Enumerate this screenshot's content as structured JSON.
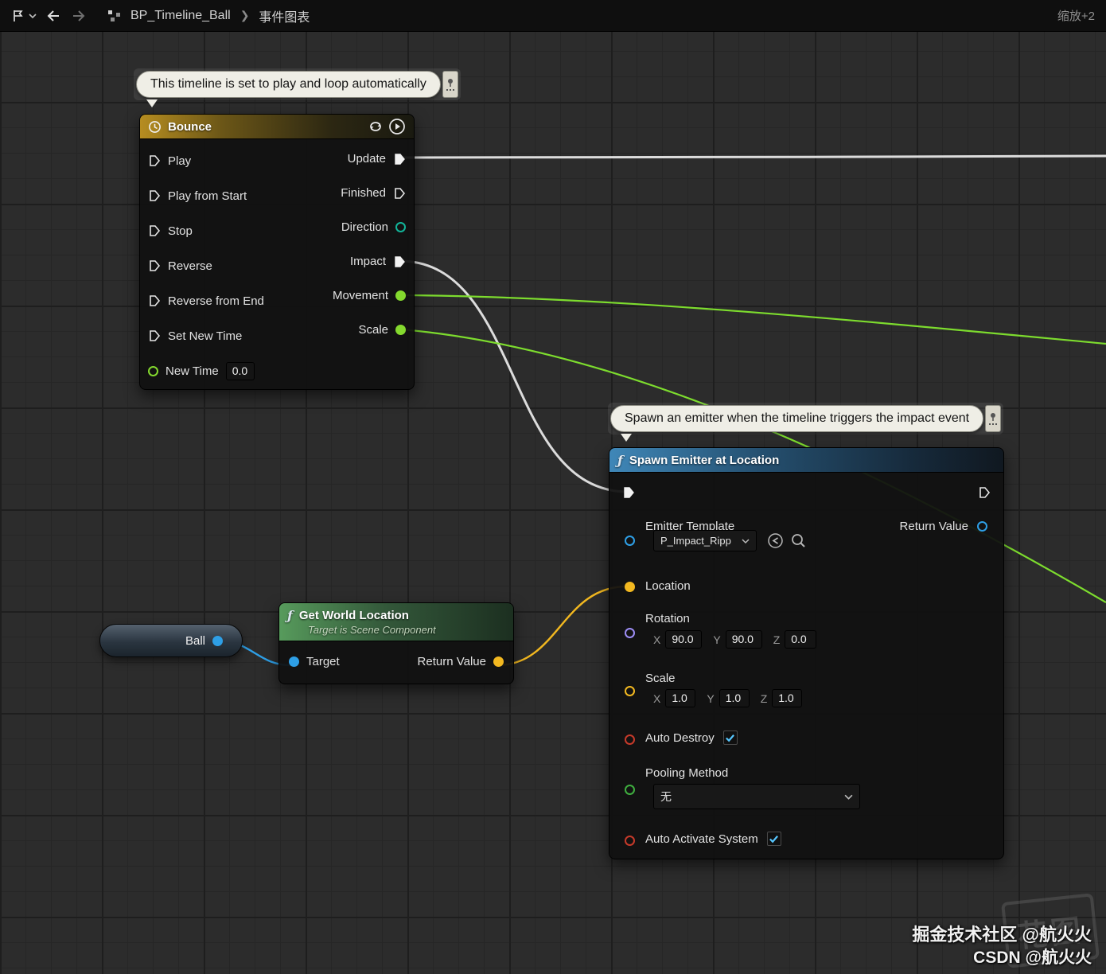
{
  "toolbar": {
    "breadcrumb_root": "BP_Timeline_Ball",
    "breadcrumb_sep": "❯",
    "breadcrumb_page": "事件图表",
    "zoom_label": "缩放+2"
  },
  "comments": {
    "timeline_note": "This timeline is set to play and loop automatically",
    "spawn_note": "Spawn an emitter when the timeline triggers the impact event"
  },
  "bounce_node": {
    "title": "Bounce",
    "inputs": [
      "Play",
      "Play from Start",
      "Stop",
      "Reverse",
      "Reverse from End",
      "Set New Time"
    ],
    "new_time_label": "New Time",
    "new_time_value": "0.0",
    "outputs": [
      "Update",
      "Finished",
      "Direction",
      "Impact",
      "Movement",
      "Scale"
    ]
  },
  "spawn_node": {
    "title": "Spawn Emitter at Location",
    "emitter_template_label": "Emitter Template",
    "emitter_template_value": "P_Impact_Ripp",
    "return_value_label": "Return Value",
    "location_label": "Location",
    "rotation_label": "Rotation",
    "rotation": {
      "x": "90.0",
      "y": "90.0",
      "z": "0.0"
    },
    "scale_label": "Scale",
    "scale": {
      "x": "1.0",
      "y": "1.0",
      "z": "1.0"
    },
    "auto_destroy_label": "Auto Destroy",
    "pooling_method_label": "Pooling Method",
    "pooling_method_value": "无",
    "auto_activate_label": "Auto Activate System"
  },
  "axis": {
    "x": "X",
    "y": "Y",
    "z": "Z"
  },
  "ball_node": {
    "label": "Ball"
  },
  "gwl_node": {
    "title": "Get World Location",
    "subtitle": "Target is Scene Component",
    "target_label": "Target",
    "return_value_label": "Return Value"
  },
  "icons": {
    "function_glyph": "ƒ"
  },
  "watermark": {
    "line1": "掘金技术社区 @航火火",
    "line2": "CSDN @航火火",
    "logo": "花图"
  }
}
